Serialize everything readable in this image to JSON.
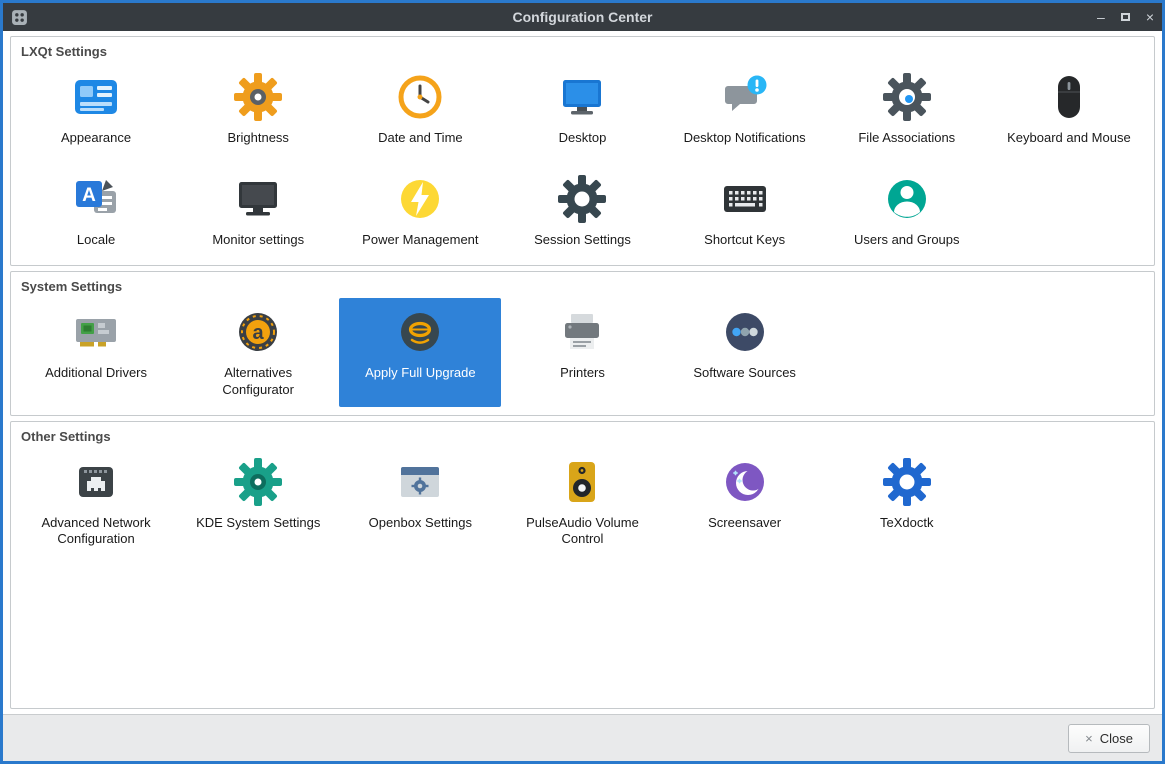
{
  "window": {
    "title": "Configuration Center",
    "controls": {
      "minimize": "–",
      "close": "×"
    }
  },
  "colors": {
    "selection_accent": "#2f82d8",
    "window_border": "#2a79cc",
    "titlebar_bg": "#363b40",
    "content_bg": "#ffffff",
    "footer_bg": "#e9eaeb"
  },
  "sections": [
    {
      "label": "LXQt Settings",
      "items": [
        {
          "label": "Appearance",
          "icon": "appearance-icon"
        },
        {
          "label": "Brightness",
          "icon": "brightness-icon"
        },
        {
          "label": "Date and Time",
          "icon": "date-and-time-icon"
        },
        {
          "label": "Desktop",
          "icon": "desktop-icon"
        },
        {
          "label": "Desktop Notifications",
          "icon": "desktop-notifications-icon"
        },
        {
          "label": "File Associations",
          "icon": "file-associations-icon"
        },
        {
          "label": "Keyboard and Mouse",
          "icon": "keyboard-and-mouse-icon"
        },
        {
          "label": "Locale",
          "icon": "locale-icon"
        },
        {
          "label": "Monitor settings",
          "icon": "monitor-settings-icon"
        },
        {
          "label": "Power Management",
          "icon": "power-management-icon"
        },
        {
          "label": "Session Settings",
          "icon": "session-settings-icon"
        },
        {
          "label": "Shortcut Keys",
          "icon": "shortcut-keys-icon"
        },
        {
          "label": "Users and Groups",
          "icon": "users-and-groups-icon"
        }
      ]
    },
    {
      "label": "System Settings",
      "items": [
        {
          "label": "Additional Drivers",
          "icon": "additional-drivers-icon"
        },
        {
          "label": "Alternatives Configurator",
          "icon": "alternatives-configurator-icon"
        },
        {
          "label": "Apply Full Upgrade",
          "icon": "apply-full-upgrade-icon",
          "selected": true
        },
        {
          "label": "Printers",
          "icon": "printers-icon"
        },
        {
          "label": "Software Sources",
          "icon": "software-sources-icon"
        }
      ]
    },
    {
      "label": "Other Settings",
      "items": [
        {
          "label": "Advanced Network Configuration",
          "icon": "advanced-network-configuration-icon"
        },
        {
          "label": "KDE System Settings",
          "icon": "kde-system-settings-icon"
        },
        {
          "label": "Openbox Settings",
          "icon": "openbox-settings-icon"
        },
        {
          "label": "PulseAudio Volume Control",
          "icon": "pulseaudio-volume-control-icon"
        },
        {
          "label": "Screensaver",
          "icon": "screensaver-icon"
        },
        {
          "label": "TeXdoctk",
          "icon": "texdoctk-icon"
        }
      ]
    }
  ],
  "footer": {
    "close_icon": "×",
    "close_label": "Close"
  }
}
